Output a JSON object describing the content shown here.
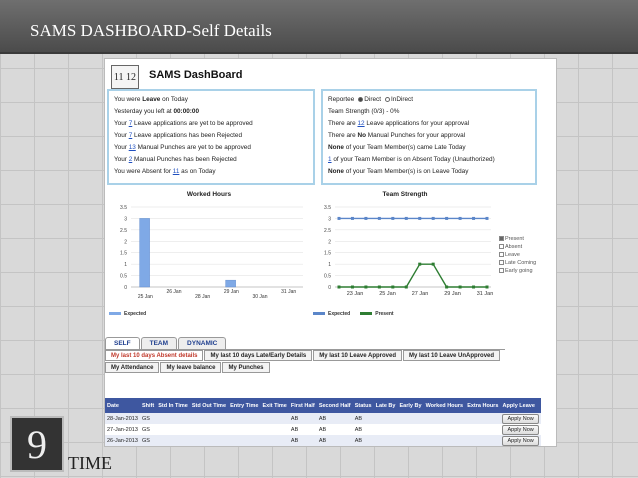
{
  "slide": {
    "title": "SAMS DASHBOARD-Self Details",
    "corner_logo": "9",
    "corner_text": "TIME"
  },
  "app": {
    "logo": "11 12",
    "title": "SAMS DashBoard"
  },
  "self_panel": [
    {
      "pre": "You were ",
      "link": "",
      "bold": "Leave",
      "post": " on Today"
    },
    {
      "pre": "Yesterday you left at ",
      "link": "",
      "bold": "00:00:00",
      "post": ""
    },
    {
      "pre": "Your ",
      "link": "7",
      "bold": "",
      "post": " Leave applications are yet to be approved"
    },
    {
      "pre": "Your ",
      "link": "7",
      "bold": "",
      "post": " Leave applications has been Rejected"
    },
    {
      "pre": "Your ",
      "link": "13",
      "bold": "",
      "post": " Manual Punches are yet to be approved"
    },
    {
      "pre": "Your ",
      "link": "2",
      "bold": "",
      "post": " Manual Punches has been Rejected"
    },
    {
      "pre": "You were Absent for ",
      "link": "11",
      "bold": "",
      "post": " as on Today"
    }
  ],
  "team_panel": {
    "reportee_label": "Reportee",
    "opt_direct": "Direct",
    "opt_indirect": "InDirect",
    "lines": [
      {
        "pre": "Team Strength (0/3) - 0%",
        "link": "",
        "bold": "",
        "post": ""
      },
      {
        "pre": "There are ",
        "link": "12",
        "bold": "",
        "post": " Leave applications for your approval"
      },
      {
        "pre": "There are ",
        "link": "",
        "bold": "No",
        "post": " Manual Punches for your approval"
      },
      {
        "pre": "",
        "link": "",
        "bold": "None",
        "post": " of your Team Member(s) came Late Today"
      },
      {
        "pre": "",
        "link": "1",
        "bold": "",
        "post": " of your Team Member is on Absent Today (Unauthorized)"
      },
      {
        "pre": "",
        "link": "",
        "bold": "None",
        "post": " of your Team Member(s) is on Leave Today"
      }
    ]
  },
  "chart_data": [
    {
      "type": "bar",
      "title": "Worked Hours",
      "ylim": [
        0,
        3.5
      ],
      "yticks": [
        "0",
        "0.5",
        "1",
        "1.5",
        "2",
        "2.5",
        "3",
        "3.5"
      ],
      "categories": [
        "25 Jan",
        "26 Jan",
        "28 Jan",
        "29 Jan",
        "30 Jan",
        "31 Jan"
      ],
      "series": [
        {
          "name": "Expected",
          "color": "#7fa9e6",
          "values": [
            3,
            0,
            0,
            0.3,
            0,
            0
          ]
        }
      ]
    },
    {
      "type": "line",
      "title": "Team Strength",
      "ylim": [
        0,
        3.5
      ],
      "yticks": [
        "0",
        "0.5",
        "1",
        "1.5",
        "2",
        "2.5",
        "3",
        "3.5"
      ],
      "categories": [
        "23 Jan",
        "25 Jan",
        "27 Jan",
        "29 Jan",
        "31 Jan"
      ],
      "series": [
        {
          "name": "Expected",
          "color": "#5b86c9",
          "values": [
            3,
            3,
            3,
            3,
            3,
            3,
            3,
            3,
            3,
            3,
            3,
            3
          ]
        },
        {
          "name": "Present",
          "color": "#2e7d32",
          "values": [
            0,
            0,
            0,
            0,
            0,
            0,
            1,
            1,
            0,
            0,
            0,
            0
          ]
        }
      ]
    }
  ],
  "team_checks": [
    {
      "label": "Present",
      "checked": true
    },
    {
      "label": "Absent",
      "checked": false
    },
    {
      "label": "Leave",
      "checked": false
    },
    {
      "label": "Late Coming",
      "checked": false
    },
    {
      "label": "Early going",
      "checked": false
    }
  ],
  "tabs": [
    "SELF",
    "TEAM",
    "DYNAMIC"
  ],
  "subtabs": [
    "My last 10 days Absent details",
    "My last 10 days Late/Early Details",
    "My last 10 Leave Approved",
    "My last 10 Leave UnApproved",
    "My Attendance",
    "My leave balance",
    "My Punches"
  ],
  "table": {
    "headers": [
      "Date",
      "Shift",
      "Std In Time",
      "Std Out Time",
      "Entry Time",
      "Exit Time",
      "First Half",
      "Second Half",
      "Status",
      "Late By",
      "Early By",
      "Worked Hours",
      "Extra Hours",
      "Apply Leave"
    ],
    "rows": [
      [
        "28-Jan-2013",
        "GS",
        "",
        "",
        "",
        "",
        "AB",
        "AB",
        "AB",
        "",
        "",
        "",
        "",
        "Apply Now"
      ],
      [
        "27-Jan-2013",
        "GS",
        "",
        "",
        "",
        "",
        "AB",
        "AB",
        "AB",
        "",
        "",
        "",
        "",
        "Apply Now"
      ],
      [
        "26-Jan-2013",
        "GS",
        "",
        "",
        "",
        "",
        "AB",
        "AB",
        "AB",
        "",
        "",
        "",
        "",
        "Apply Now"
      ]
    ]
  }
}
